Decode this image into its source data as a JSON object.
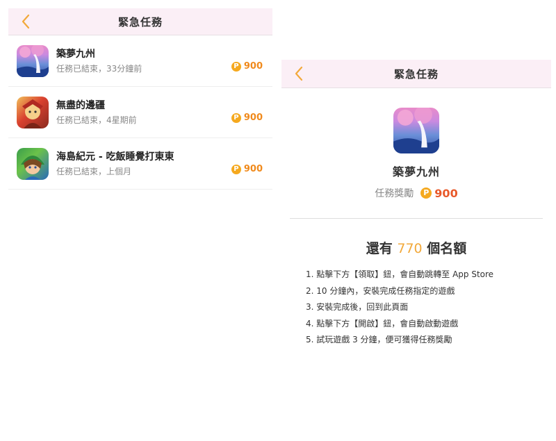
{
  "left": {
    "title": "緊急任務",
    "tasks": [
      {
        "name": "築夢九州",
        "status": "任務已結束，33分鐘前",
        "reward": "900",
        "icon": "game-icon-dream-nine-states"
      },
      {
        "name": "無盡的邊疆",
        "status": "任務已結束，4星期前",
        "reward": "900",
        "icon": "game-icon-endless-frontier"
      },
      {
        "name": "海島紀元 - 吃飯睡覺打東東",
        "status": "任務已結束，上個月",
        "reward": "900",
        "icon": "game-icon-island-era"
      }
    ]
  },
  "right": {
    "title": "緊急任務",
    "game_name": "築夢九州",
    "reward_label": "任務獎勵",
    "reward_value": "900",
    "slots_prefix": "還有",
    "slots_number": "770",
    "slots_suffix": "個名額",
    "steps": [
      "1. 點擊下方【領取】鈕，會自動跳轉至 App Store",
      "2. 10 分鐘內，安裝完成任務指定的遊戲",
      "3. 安裝完成後，回到此頁面",
      "4. 點擊下方【開啟】鈕，會自動啟動遊戲",
      "5. 試玩遊戲 3 分鐘，便可獲得任務獎勵"
    ]
  },
  "coin_symbol": "P",
  "colors": {
    "nav_bg": "#fbeff6",
    "accent_orange": "#f2a93b",
    "reward_red": "#e8592a",
    "coin": "#f5a91f"
  }
}
